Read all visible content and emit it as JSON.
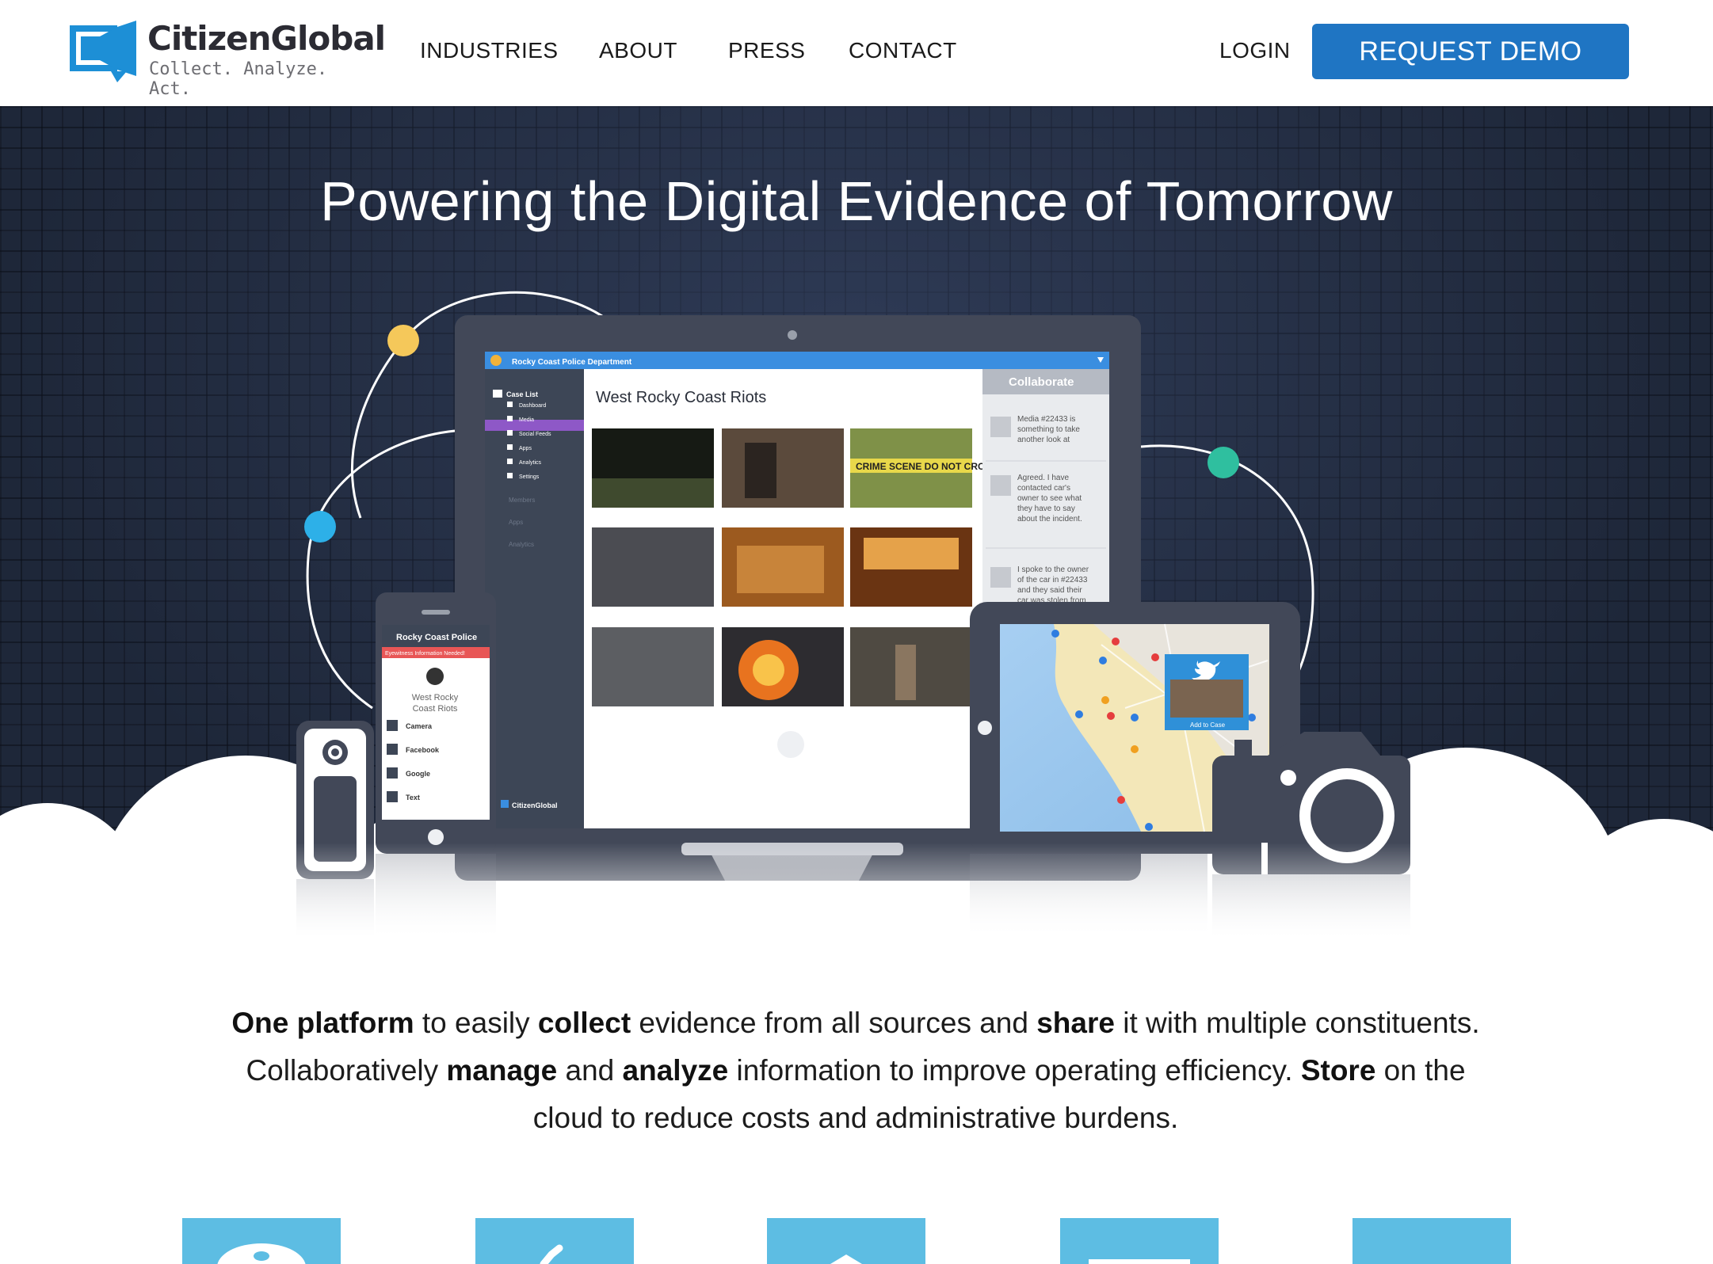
{
  "brand": {
    "name": "CitizenGlobal",
    "tagline": "Collect. Analyze. Act.",
    "colors": {
      "primary": "#1f75c3",
      "logo_blue": "#1d8fd6",
      "tile": "#5dbde3"
    }
  },
  "nav": {
    "items": [
      {
        "label": "INDUSTRIES"
      },
      {
        "label": "ABOUT"
      },
      {
        "label": "PRESS"
      },
      {
        "label": "CONTACT"
      }
    ],
    "login_label": "LOGIN",
    "demo_label": "REQUEST DEMO"
  },
  "hero": {
    "title": "Powering the Digital Evidence of Tomorrow",
    "monitor_app": {
      "org": "Rocky Coast Police Department",
      "case_list": "Case List",
      "sidebar_items": [
        "Dashboard",
        "Media",
        "Social Feeds",
        "Apps",
        "Analytics",
        "Settings"
      ],
      "sidebar_secondary": [
        "Members",
        "Apps",
        "Analytics"
      ],
      "brand": "CitizenGlobal",
      "case_title": "West Rocky Coast Riots",
      "collaborate": "Collaborate",
      "comment_1": "Media #22433 is something to take another look at",
      "comment_2": "Agreed. I have contacted car's owner to see what they have to say about the incident.",
      "comment_3": "I spoke to the owner of the car in #22433 and they said their car was stolen from",
      "tape_text": "CRIME SCENE DO NOT CROSS"
    },
    "phone_app": {
      "title": "Rocky Coast Police",
      "alert": "Eyewitness Information Needed!",
      "case": "West Rocky Coast Riots",
      "options": [
        "Camera",
        "Facebook",
        "Google",
        "Text"
      ]
    },
    "tablet_app": {
      "popup_button": "Add to Case",
      "popup_icon": "twitter-bird-icon"
    }
  },
  "description": {
    "line1": [
      {
        "text": "One platform",
        "bold": true
      },
      {
        "text": " to easily ",
        "bold": false
      },
      {
        "text": "collect",
        "bold": true
      },
      {
        "text": " evidence from all sources and ",
        "bold": false
      },
      {
        "text": "share",
        "bold": true
      },
      {
        "text": " it with multiple constituents.",
        "bold": false
      }
    ],
    "line2": [
      {
        "text": "Collaboratively ",
        "bold": false
      },
      {
        "text": "manage",
        "bold": true
      },
      {
        "text": " and ",
        "bold": false
      },
      {
        "text": "analyze",
        "bold": true
      },
      {
        "text": " information to improve operating efficiency. ",
        "bold": false
      },
      {
        "text": "Store",
        "bold": true
      },
      {
        "text": " on the",
        "bold": false
      }
    ],
    "line3": [
      {
        "text": "cloud to reduce costs and administrative burdens.",
        "bold": false
      }
    ]
  },
  "features": {
    "tiles": [
      {
        "icon": "phone-icon"
      },
      {
        "icon": "check-icon"
      },
      {
        "icon": "cloud-icon"
      },
      {
        "icon": "browser-icon"
      },
      {
        "icon": "blank-icon"
      }
    ]
  }
}
